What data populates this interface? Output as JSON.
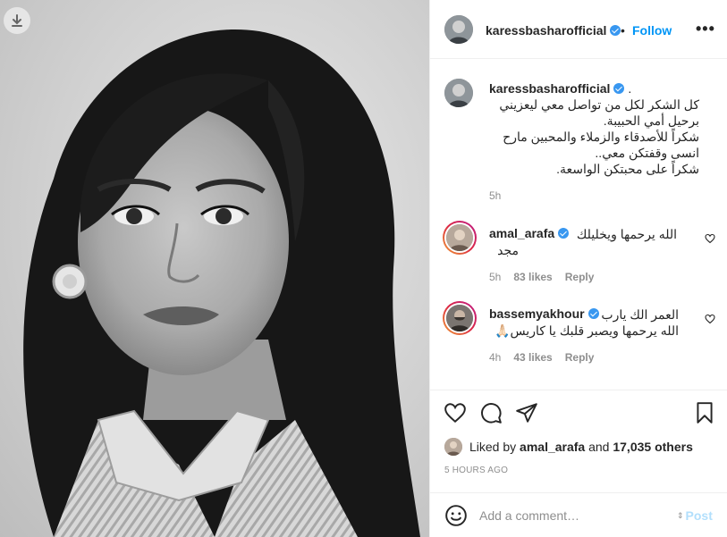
{
  "post": {
    "username": "karessbasharofficial",
    "follow_label": "Follow",
    "dot": "•",
    "more_label": "•••"
  },
  "caption": {
    "username": "karessbasharofficial",
    "trailing": ".",
    "lines": [
      "كل الشكر لكل من تواصل معي ليعزيني",
      "برحيل أمي الحبيبة.",
      "شكراً للأصدقاء والزملاء والمحبين مارح",
      "انسى وقفتكن معي..",
      "شكراً على محبتكن الواسعة."
    ],
    "time": "5h"
  },
  "comments": [
    {
      "username": "amal_arafa",
      "text_line1": "الله يرحمها ويخليلك",
      "text_line2": "مجد",
      "time": "5h",
      "likes": "83 likes",
      "reply": "Reply"
    },
    {
      "username": "bassemyakhour",
      "text_line1": "العمر الك يارب",
      "text_line2": "الله يرحمها ويصبر قلبك يا كاريس🙏🏻",
      "time": "4h",
      "likes": "43 likes",
      "reply": "Reply"
    }
  ],
  "likes": {
    "prefix": "Liked by",
    "user": "amal_arafa",
    "and": "and",
    "others": "17,035 others"
  },
  "post_time": "5 HOURS AGO",
  "add_comment": {
    "placeholder": "Add a comment…",
    "post_label": "Post",
    "post_color": "#b2dffc"
  },
  "colors": {
    "accent": "#0095f6",
    "verified": "#3897f0",
    "muted": "#8e8e8e"
  },
  "icons": {
    "download": "download-icon",
    "heart": "heart-icon",
    "comment": "comment-icon",
    "share": "share-icon",
    "save": "bookmark-icon",
    "emoji": "emoji-icon",
    "more": "more-options-icon",
    "verified": "verified-badge-icon"
  }
}
